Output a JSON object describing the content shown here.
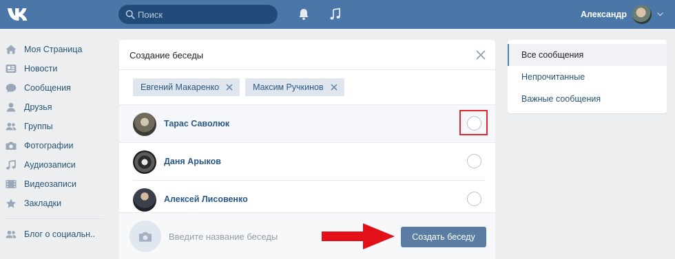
{
  "header": {
    "search_placeholder": "Поиск",
    "user_name": "Александр"
  },
  "sidebar": {
    "items": [
      {
        "label": "Моя Страница",
        "icon": "home-icon"
      },
      {
        "label": "Новости",
        "icon": "news-icon"
      },
      {
        "label": "Сообщения",
        "icon": "messages-icon"
      },
      {
        "label": "Друзья",
        "icon": "friends-icon"
      },
      {
        "label": "Группы",
        "icon": "groups-icon"
      },
      {
        "label": "Фотографии",
        "icon": "camera-icon"
      },
      {
        "label": "Аудиозаписи",
        "icon": "music-icon"
      },
      {
        "label": "Видеозаписи",
        "icon": "video-icon"
      },
      {
        "label": "Закладки",
        "icon": "star-icon"
      }
    ],
    "extra": {
      "label": "Блог о социальн..",
      "icon": "group-icon"
    }
  },
  "modal": {
    "title": "Создание беседы",
    "chips": [
      "Евгений Макаренко",
      "Максим Ручкинов"
    ],
    "contacts": [
      {
        "name": "Тарас Саволюк"
      },
      {
        "name": "Даня Арыков"
      },
      {
        "name": "Алексей Лисовенко"
      }
    ],
    "name_placeholder": "Введите название беседы",
    "create_label": "Создать беседу"
  },
  "right_menu": {
    "items": [
      "Все сообщения",
      "Непрочитанные",
      "Важные сообщения"
    ]
  },
  "colors": {
    "header": "#4a76a8",
    "accent": "#5b7da3",
    "highlight_box": "#e2262d",
    "arrow": "#e3101a"
  }
}
